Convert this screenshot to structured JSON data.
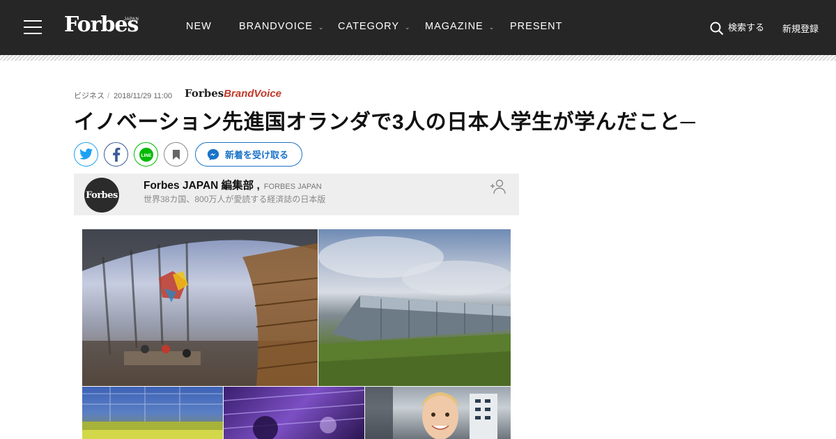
{
  "header": {
    "logo": "Forbes",
    "logo_sub": "JAPAN",
    "nav": [
      {
        "label": "NEW",
        "has_dropdown": false
      },
      {
        "label": "BRANDVOICE",
        "has_dropdown": true
      },
      {
        "label": "CATEGORY",
        "has_dropdown": true
      },
      {
        "label": "MAGAZINE",
        "has_dropdown": true
      },
      {
        "label": "PRESENT",
        "has_dropdown": false
      }
    ],
    "search_label": "検索する",
    "register_label": "新規登録"
  },
  "article": {
    "category": "ビジネス",
    "datetime": "2018/11/29 11:00",
    "brandvoice_logo": {
      "forbes": "Forbes",
      "brand": "BrandVoice"
    },
    "title": "イノベーション先進国オランダで3人の日本人学生が学んだこと─",
    "subscribe_label": "新着を受け取る",
    "share_icons": [
      "twitter-icon",
      "facebook-icon",
      "line-icon",
      "bookmark-icon"
    ]
  },
  "author": {
    "avatar_text": "Forbes",
    "name": "Forbes JAPAN 編集部 ,",
    "org": "FORBES JAPAN",
    "description": "世界38カ国、800万人が愛読する経済誌の日本版"
  },
  "colors": {
    "header_bg": "#262626",
    "twitter": "#1da1f2",
    "facebook": "#3b5998",
    "line": "#00b900",
    "subscribe": "#1a73c8",
    "brandvoice_red": "#c0392b"
  }
}
